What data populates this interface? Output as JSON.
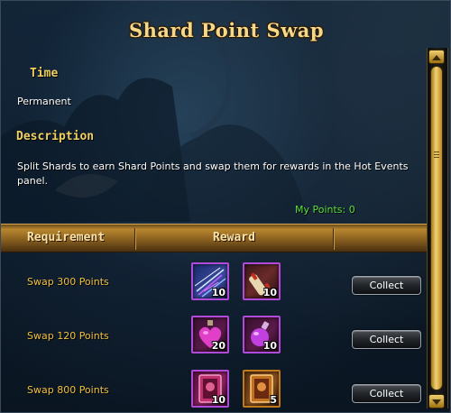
{
  "window": {
    "title": "Shard Point Swap"
  },
  "time": {
    "heading": "Time",
    "value": "Permanent"
  },
  "description": {
    "heading": "Description",
    "text": "Split Shards to earn Shard Points and swap them for rewards in the Hot Events panel."
  },
  "my_points": "My Points: 0",
  "table": {
    "headers": {
      "requirement": "Requirement",
      "reward": "Reward"
    },
    "rows": [
      {
        "requirement": "Swap 300 Points",
        "rewards": [
          {
            "icon": "arrow-volley-skill-icon",
            "count": "10"
          },
          {
            "icon": "scroll-icon",
            "count": "10"
          }
        ],
        "button": "Collect"
      },
      {
        "requirement": "Swap 120 Points",
        "rewards": [
          {
            "icon": "heart-potion-icon",
            "count": "20"
          },
          {
            "icon": "purple-potion-icon",
            "count": "10"
          }
        ],
        "button": "Collect"
      },
      {
        "requirement": "Swap 800 Points",
        "rewards": [
          {
            "icon": "purple-card-icon",
            "count": "10"
          },
          {
            "icon": "gold-card-icon",
            "count": "5"
          }
        ],
        "button": "Collect"
      }
    ]
  },
  "colors": {
    "title": "#f6d88a",
    "section_heading": "#f0d060",
    "points": "#58e23a",
    "requirement": "#f0c040",
    "epic_border": "#b04ad8",
    "legendary_border": "#c07a1c"
  }
}
